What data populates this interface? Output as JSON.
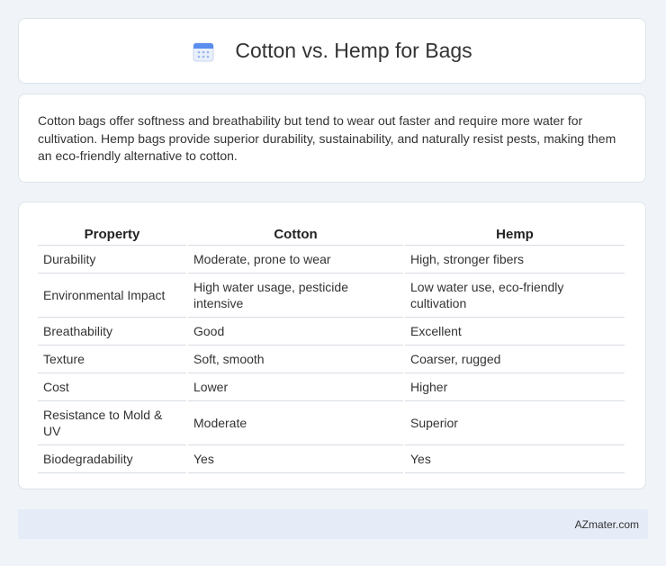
{
  "header": {
    "title": "Cotton vs. Hemp for Bags",
    "icon": "calendar-icon"
  },
  "intro": {
    "text": "Cotton bags offer softness and breathability but tend to wear out faster and require more water for cultivation. Hemp bags provide superior durability, sustainability, and naturally resist pests, making them an eco-friendly alternative to cotton."
  },
  "table": {
    "headers": [
      "Property",
      "Cotton",
      "Hemp"
    ],
    "rows": [
      [
        "Durability",
        "Moderate, prone to wear",
        "High, stronger fibers"
      ],
      [
        "Environmental Impact",
        "High water usage, pesticide intensive",
        "Low water use, eco-friendly cultivation"
      ],
      [
        "Breathability",
        "Good",
        "Excellent"
      ],
      [
        "Texture",
        "Soft, smooth",
        "Coarser, rugged"
      ],
      [
        "Cost",
        "Lower",
        "Higher"
      ],
      [
        "Resistance to Mold & UV",
        "Moderate",
        "Superior"
      ],
      [
        "Biodegradability",
        "Yes",
        "Yes"
      ]
    ]
  },
  "footer": {
    "text": "AZmater.com"
  },
  "colors": {
    "background": "#f0f4f9",
    "card": "#ffffff",
    "footer_bg": "#e6ecf7",
    "icon_blue": "#5b8def"
  }
}
